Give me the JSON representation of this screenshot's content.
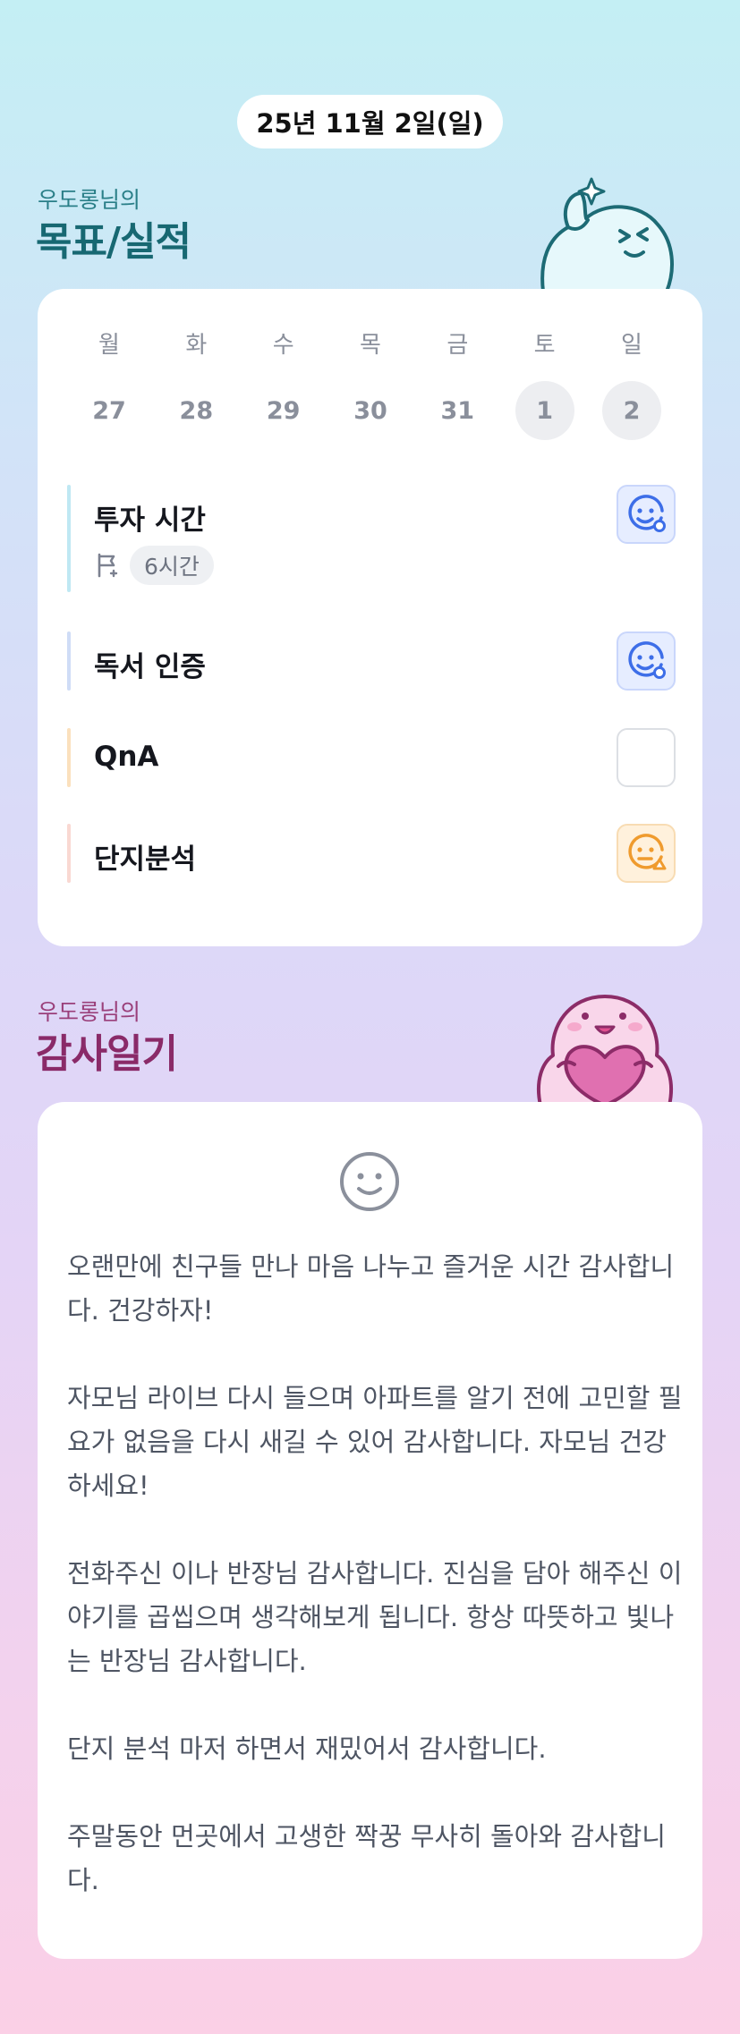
{
  "header": {
    "date": "25년 11월 2일(일)"
  },
  "goals": {
    "owner": "우도롱님의",
    "title": "목표/실적",
    "week": [
      {
        "dow": "월",
        "day": "27",
        "highlight": false
      },
      {
        "dow": "화",
        "day": "28",
        "highlight": false
      },
      {
        "dow": "수",
        "day": "29",
        "highlight": false
      },
      {
        "dow": "목",
        "day": "30",
        "highlight": false
      },
      {
        "dow": "금",
        "day": "31",
        "highlight": false
      },
      {
        "dow": "토",
        "day": "1",
        "highlight": true
      },
      {
        "dow": "일",
        "day": "2",
        "highlight": true
      }
    ],
    "items": [
      {
        "label": "투자 시간",
        "value": "6시간",
        "status": "blue-smile",
        "bar_color": "#bfe8f3"
      },
      {
        "label": "독서 인증",
        "status": "blue-smile",
        "bar_color": "#cfdcf6"
      },
      {
        "label": "QnA",
        "status": "empty",
        "bar_color": "#fbe0bd"
      },
      {
        "label": "단지분석",
        "status": "orange-meh",
        "bar_color": "#f9d8d2"
      }
    ]
  },
  "thanks": {
    "owner": "우도롱님의",
    "title": "감사일기",
    "mood_icon": "smile-face-icon",
    "entries": [
      "오랜만에 친구들 만나 마음 나누고 즐거운 시간 감사합니다. 건강하자!",
      "자모님 라이브 다시 들으며 아파트를 알기 전에 고민할 필요가 없음을 다시 새길 수 있어 감사합니다. 자모님 건강하세요!",
      "전화주신 이나 반장님 감사합니다. 진심을 담아 해주신 이야기를 곱씹으며 생각해보게 됩니다. 항상 따뜻하고 빛나는 반장님 감사합니다.",
      "단지 분석 마저 하면서 재밌어서 감사합니다.",
      "주말동안 먼곳에서 고생한 짝꿍 무사히 돌아와 감사합니다."
    ]
  },
  "colors": {
    "goal_title": "#176872",
    "thanks_title": "#8a2a68",
    "status_blue": "#3d6ee8",
    "status_orange": "#ef9b2e"
  }
}
